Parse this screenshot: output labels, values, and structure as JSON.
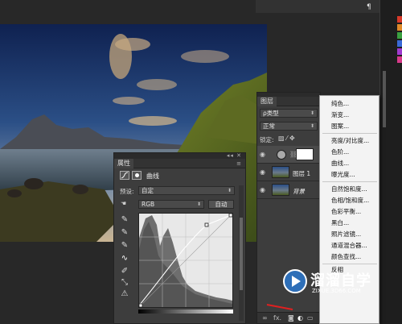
{
  "properties_panel": {
    "tab_label": "属性",
    "adjustment_name": "曲线",
    "preset_label": "预设:",
    "preset_value": "自定",
    "channel_value": "RGB",
    "auto_button": "自动"
  },
  "layers_panel": {
    "tab_label": "图层",
    "filter_value": "ρ类型",
    "blend_mode": "正常",
    "lock_label": "锁定:",
    "layer_1_name": "图层 1",
    "background_name": "背景",
    "bottom_fx": "fx."
  },
  "adjustment_menu": {
    "items_group_1": [
      "纯色...",
      "渐变...",
      "图案..."
    ],
    "items_group_2": [
      "亮度/对比度...",
      "色阶...",
      "曲线...",
      "曝光度..."
    ],
    "items_group_3": [
      "自然饱和度...",
      "色相/饱和度...",
      "色彩平衡...",
      "黑白...",
      "照片滤镜...",
      "通道混合器...",
      "颜色查找..."
    ],
    "items_group_4": [
      "反相"
    ]
  },
  "watermark": {
    "title": "溜溜自学",
    "url": "ZIXUE.3D66.COM"
  },
  "colors": {
    "panel_bg": "#3d3d3d",
    "workspace_bg": "#282828",
    "menu_bg": "#f3f3f3",
    "watermark_blue": "#2e6fb8"
  },
  "icons": [
    "pilcrow-icon",
    "eye-icon",
    "curves-icon",
    "eyedropper-icon",
    "pencil-icon",
    "smooth-icon",
    "histogram-warning-icon",
    "link-icon",
    "chevron-down-icon"
  ]
}
